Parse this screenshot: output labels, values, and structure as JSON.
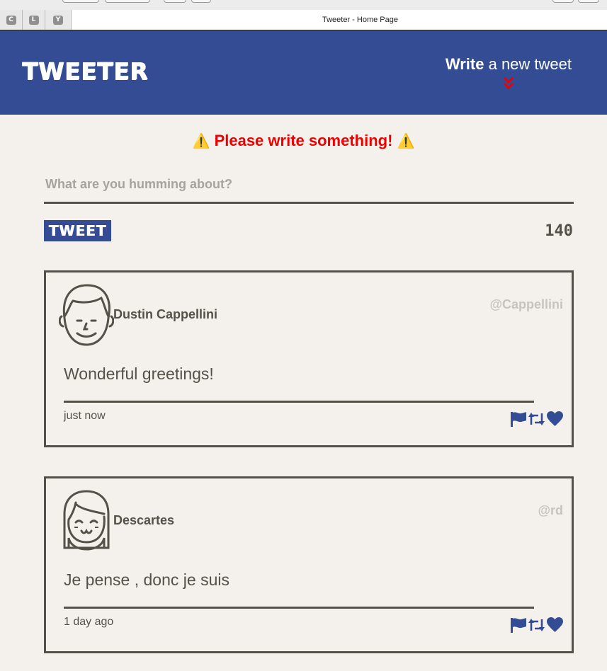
{
  "browser": {
    "tab_title": "Tweeter - Home Page",
    "extensions": [
      "C",
      "L",
      "Y"
    ]
  },
  "nav": {
    "brand": "TWEETER",
    "compose_bold": "Write",
    "compose_rest": " a new tweet",
    "compose_icon": "double-chevron-down-icon"
  },
  "compose": {
    "error": "Please write something!",
    "error_icon": "⚠️",
    "placeholder": "What are you humming about?",
    "submit_label": "TWEET",
    "counter": "140"
  },
  "tweets": [
    {
      "name": "Dustin Cappellini",
      "handle": "@Cappellini",
      "text": "Wonderful greetings!",
      "time": "just now",
      "avatar": "smiling-man-avatar"
    },
    {
      "name": "Descartes",
      "handle": "@rd",
      "text": "Je pense , donc je suis",
      "time": "1 day ago",
      "avatar": "girl-with-bangs-avatar"
    }
  ],
  "colors": {
    "brand_blue": "#334c93",
    "error_red": "#ec0000",
    "text_dark": "#545149",
    "handle_grey": "#c7c4bf",
    "background": "#f4f1ec"
  }
}
